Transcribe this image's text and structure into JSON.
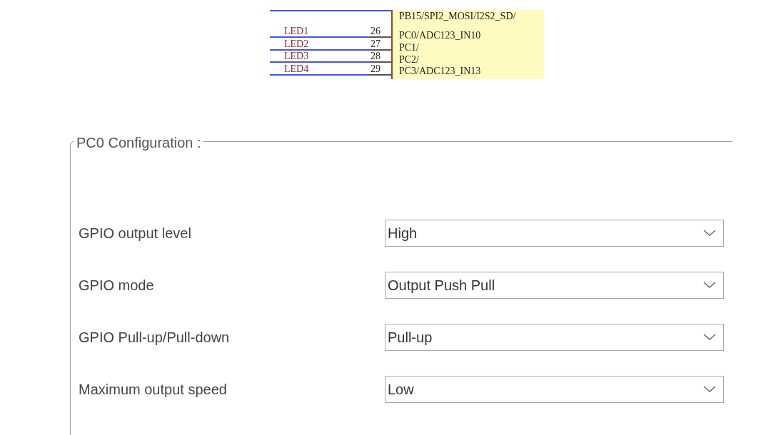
{
  "schematic": {
    "signals": [
      "PB15/SPI2_MOSI/I2S2_SD/",
      "PC0/ADC123_IN10",
      "PC1/",
      "PC2/",
      "PC3/ADC123_IN13"
    ],
    "pins": [
      {
        "net": "LED1",
        "number": "26"
      },
      {
        "net": "LED2",
        "number": "27"
      },
      {
        "net": "LED3",
        "number": "28"
      },
      {
        "net": "LED4",
        "number": "29"
      }
    ]
  },
  "configuration": {
    "title": "PC0 Configuration :",
    "settings": [
      {
        "label": "GPIO output level",
        "value": "High"
      },
      {
        "label": "GPIO mode",
        "value": "Output Push Pull"
      },
      {
        "label": "GPIO Pull-up/Pull-down",
        "value": "Pull-up"
      },
      {
        "label": "Maximum output speed",
        "value": "Low"
      }
    ]
  }
}
